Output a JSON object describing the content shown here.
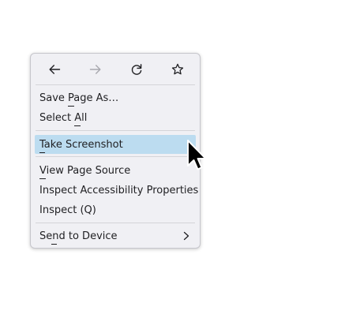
{
  "context_menu": {
    "nav": {
      "back_icon": "arrow-left-icon",
      "forward_icon": "arrow-right-icon",
      "forward_disabled": true,
      "reload_icon": "reload-icon",
      "bookmark_icon": "star-icon"
    },
    "items": [
      {
        "label": "Save Page As…",
        "accesskey": "P"
      },
      {
        "label": "Select All",
        "accesskey": "A"
      },
      {
        "label": "Take Screenshot",
        "accesskey": "T",
        "highlighted": true
      },
      {
        "label": "View Page Source",
        "accesskey": "V"
      },
      {
        "label": "Inspect Accessibility Properties",
        "accesskey": ""
      },
      {
        "label": "Inspect (Q)",
        "accesskey": ""
      },
      {
        "label": "Send to Device",
        "accesskey": "n",
        "has_submenu": true
      }
    ]
  },
  "colors": {
    "menu_bg": "#f0f0f4",
    "highlight_bg": "#bcdcf0",
    "text": "#1f1f22",
    "disabled_icon": "#a8a8ae"
  },
  "cursor_icon": "mouse-pointer-icon"
}
